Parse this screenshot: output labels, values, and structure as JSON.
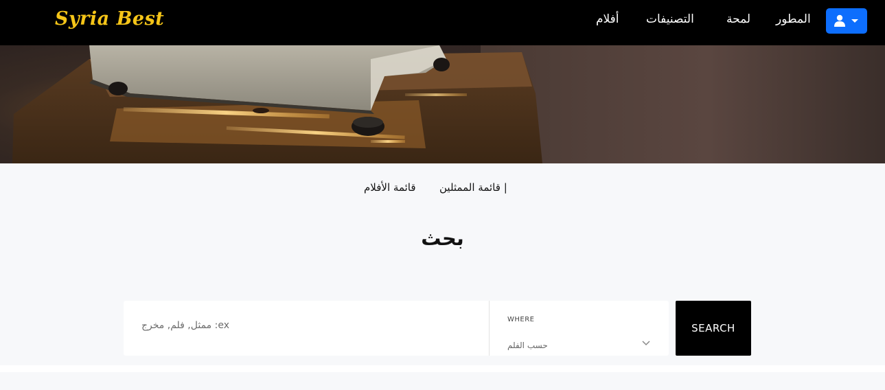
{
  "navbar": {
    "brand": "Syria Best",
    "items": [
      "أفلام",
      "التصنيفات",
      "لمحة",
      "المطور"
    ],
    "user_icon": "user-icon",
    "accent": "#0d6efd",
    "brand_color": "#f5c518"
  },
  "hero": {
    "image": "film-projector-photo"
  },
  "subnav": {
    "actors": "قائمة الممثلين |",
    "films": "قائمة الأفلام"
  },
  "page_title": "بحث",
  "search": {
    "placeholder": "ex: ممثل, فلم, مخرج",
    "where_label": "WHERE",
    "where_value": "حسب الفلم",
    "button": "SEARCH"
  }
}
